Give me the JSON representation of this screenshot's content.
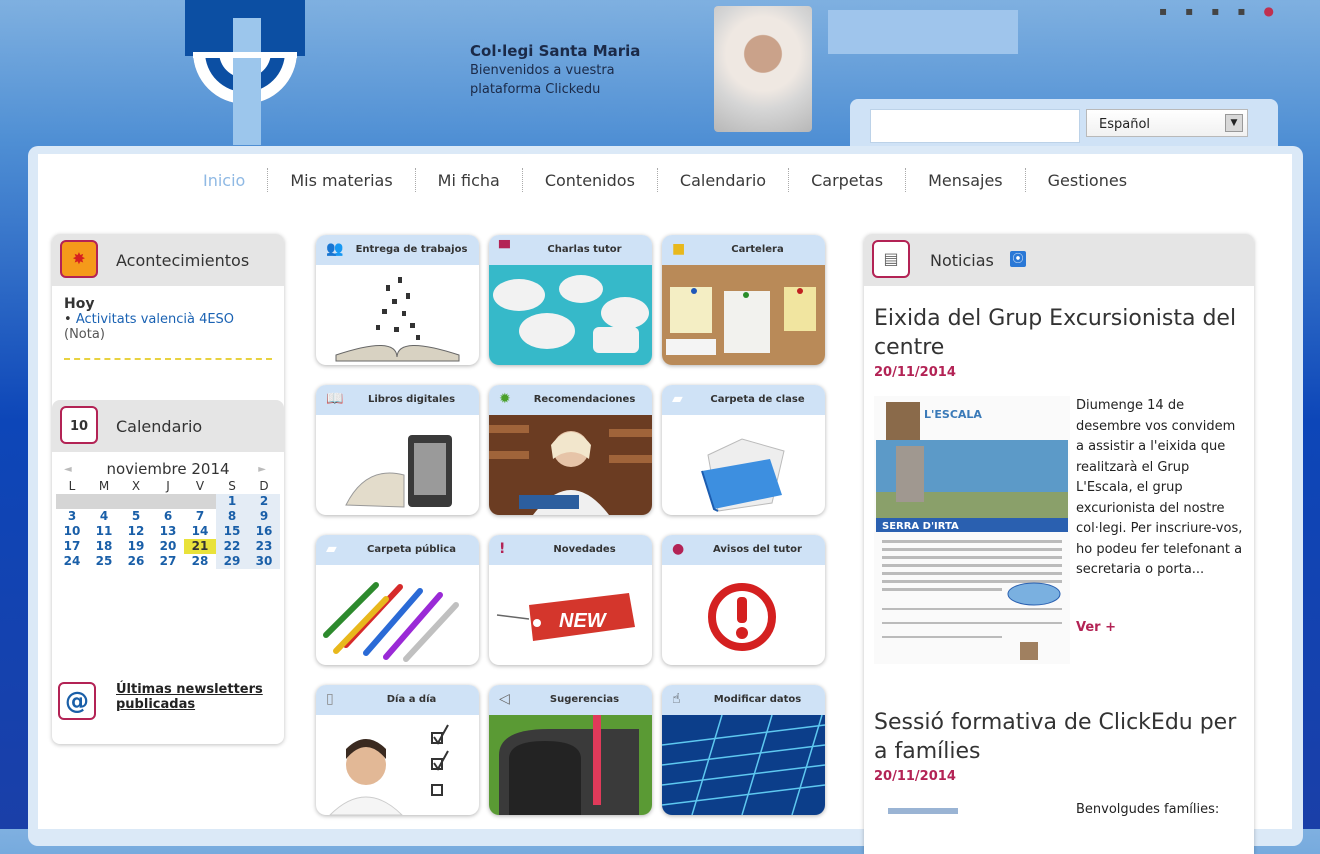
{
  "header": {
    "school_name": "Col·legi Santa Maria",
    "welcome_line1": "Bienvenidos a vuestra",
    "welcome_line2": "plataforma Clickedu",
    "language_selected": "Español",
    "top_icons": [
      "user-icon",
      "help-icon",
      "close-icon",
      "exit-icon",
      "power-icon"
    ]
  },
  "nav": {
    "items": [
      "Inicio",
      "Mis materias",
      "Mi ficha",
      "Contenidos",
      "Calendario",
      "Carpetas",
      "Mensajes",
      "Gestiones"
    ],
    "active": "Inicio"
  },
  "events": {
    "title": "Acontecimientos",
    "day": "Hoy",
    "item_link": "Activitats valencià 4ESO",
    "item_note": "(Nota)"
  },
  "calendar": {
    "title": "Calendario",
    "icon_day": "10",
    "month": "noviembre 2014",
    "weekdays": [
      "L",
      "M",
      "X",
      "J",
      "V",
      "S",
      "D"
    ],
    "weeks": [
      [
        "",
        "",
        "",
        "",
        "",
        "1",
        "2"
      ],
      [
        "3",
        "4",
        "5",
        "6",
        "7",
        "8",
        "9"
      ],
      [
        "10",
        "11",
        "12",
        "13",
        "14",
        "15",
        "16"
      ],
      [
        "17",
        "18",
        "19",
        "20",
        "21",
        "22",
        "23"
      ],
      [
        "24",
        "25",
        "26",
        "27",
        "28",
        "29",
        "30"
      ]
    ],
    "today": "21"
  },
  "newsletters": {
    "label": "Últimas newsletters publicadas"
  },
  "tiles": [
    {
      "label": "Entrega de trabajos",
      "icon": "people-icon"
    },
    {
      "label": "Charlas tutor",
      "icon": "speech-bubble-icon"
    },
    {
      "label": "Cartelera",
      "icon": "note-icon"
    },
    {
      "label": "Libros digitales",
      "icon": "book-icon"
    },
    {
      "label": "Recomendaciones",
      "icon": "star-icon"
    },
    {
      "label": "Carpeta de clase",
      "icon": "folder-icon"
    },
    {
      "label": "Carpeta pública",
      "icon": "folder-icon"
    },
    {
      "label": "Novedades",
      "icon": "exclamation-icon"
    },
    {
      "label": "Avisos del tutor",
      "icon": "alert-icon"
    },
    {
      "label": "Día a día",
      "icon": "page-icon"
    },
    {
      "label": "Sugerencias",
      "icon": "megaphone-icon"
    },
    {
      "label": "Modificar datos",
      "icon": "hand-pointer-icon"
    }
  ],
  "tile_image_text": {
    "new_tag": "NEW",
    "leaflet_title": "L'ESCALA",
    "leaflet_banner": "SERRA D'IRTA"
  },
  "news": {
    "title": "Noticias",
    "items": [
      {
        "title": "Eixida del Grup Excursionista del centre",
        "date": "20/11/2014",
        "text": "Diumenge 14 de desembre vos convidem a assistir a l'eixida que realitzarà el Grup L'Escala, el grup excurionista del nostre col·legi. Per inscriure-vos, ho podeu fer telefonant a secretaria o porta...",
        "more": "Ver +"
      },
      {
        "title": "Sessió formativa de ClickEdu per a famílies",
        "date": "20/11/2014",
        "text": "Benvolgudes famílies:"
      }
    ]
  },
  "colors": {
    "accent": "#b32355",
    "link": "#1a62b3",
    "nav_active": "#8fb9e4",
    "highlight": "#e9e23a"
  }
}
